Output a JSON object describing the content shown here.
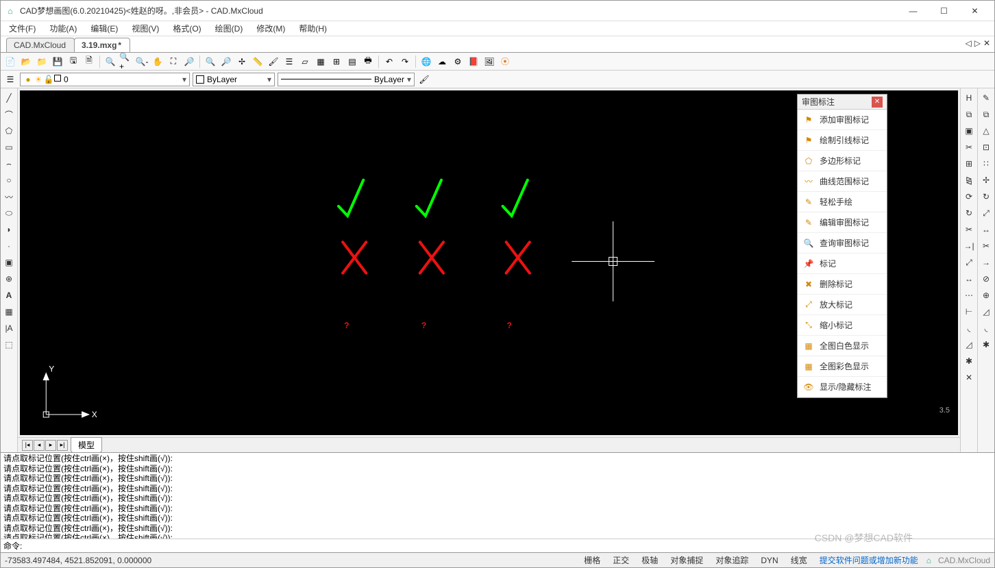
{
  "title": "CAD梦想画图(6.0.20210425)<姓赵的呀。,非会员> - CAD.MxCloud",
  "menus": {
    "file": "文件(F)",
    "func": "功能(A)",
    "edit": "编辑(E)",
    "view": "视图(V)",
    "format": "格式(O)",
    "draw": "绘图(D)",
    "modify": "修改(M)",
    "help": "帮助(H)"
  },
  "tabs": {
    "tab1": "CAD.MxCloud",
    "tab2": "3.19.mxg",
    "dirty": "*"
  },
  "propbar": {
    "layer_name": "0",
    "color_label": "ByLayer",
    "ltype_label": "ByLayer"
  },
  "review_panel": {
    "title": "审图标注",
    "items": [
      {
        "icon": "⚑",
        "label": "添加审图标记"
      },
      {
        "icon": "⚑",
        "label": "绘制引线标记"
      },
      {
        "icon": "⬠",
        "label": "多边形标记"
      },
      {
        "icon": "〰",
        "label": "曲线范围标记"
      },
      {
        "icon": "✎",
        "label": "轻松手绘"
      },
      {
        "icon": "✎",
        "label": "编辑审图标记"
      },
      {
        "icon": "🔍",
        "label": "查询审图标记"
      },
      {
        "icon": "📌",
        "label": "标记"
      },
      {
        "icon": "✖",
        "label": "删除标记"
      },
      {
        "icon": "⤢",
        "label": "放大标记"
      },
      {
        "icon": "⤡",
        "label": "缩小标记"
      },
      {
        "icon": "▦",
        "label": "全图白色显示"
      },
      {
        "icon": "▦",
        "label": "全图彩色显示"
      },
      {
        "icon": "👁",
        "label": "显示/隐藏标注"
      }
    ]
  },
  "model_tab": "模型",
  "cmd_log": [
    "请点取标记位置(按住ctrl画(×)，按住shift画(√)):",
    "请点取标记位置(按住ctrl画(×)，按住shift画(√)):",
    "请点取标记位置(按住ctrl画(×)，按住shift画(√)):",
    "请点取标记位置(按住ctrl画(×)，按住shift画(√)):",
    "请点取标记位置(按住ctrl画(×)，按住shift画(√)):",
    "请点取标记位置(按住ctrl画(×)，按住shift画(√)):",
    "请点取标记位置(按住ctrl画(×)，按住shift画(√)):",
    "请点取标记位置(按住ctrl画(×)，按住shift画(√)):",
    "请点取标记位置(按住ctrl画(×)，按住shift画(√)):"
  ],
  "cmd_prompt": "命令:",
  "coords": "-73583.497484,  4521.852091,  0.000000",
  "status": {
    "grid": "栅格",
    "ortho": "正交",
    "polar": "极轴",
    "osnap": "对象捕捉",
    "otrack": "对象追踪",
    "dyn": "DYN",
    "lw": "线宽",
    "link": "提交软件问题或增加新功能",
    "brand": "CAD.MxCloud"
  },
  "canvas": {
    "axis_y": "Y",
    "axis_x": "X",
    "scale": "3.5"
  },
  "watermark": "CSDN @梦想CAD软件"
}
